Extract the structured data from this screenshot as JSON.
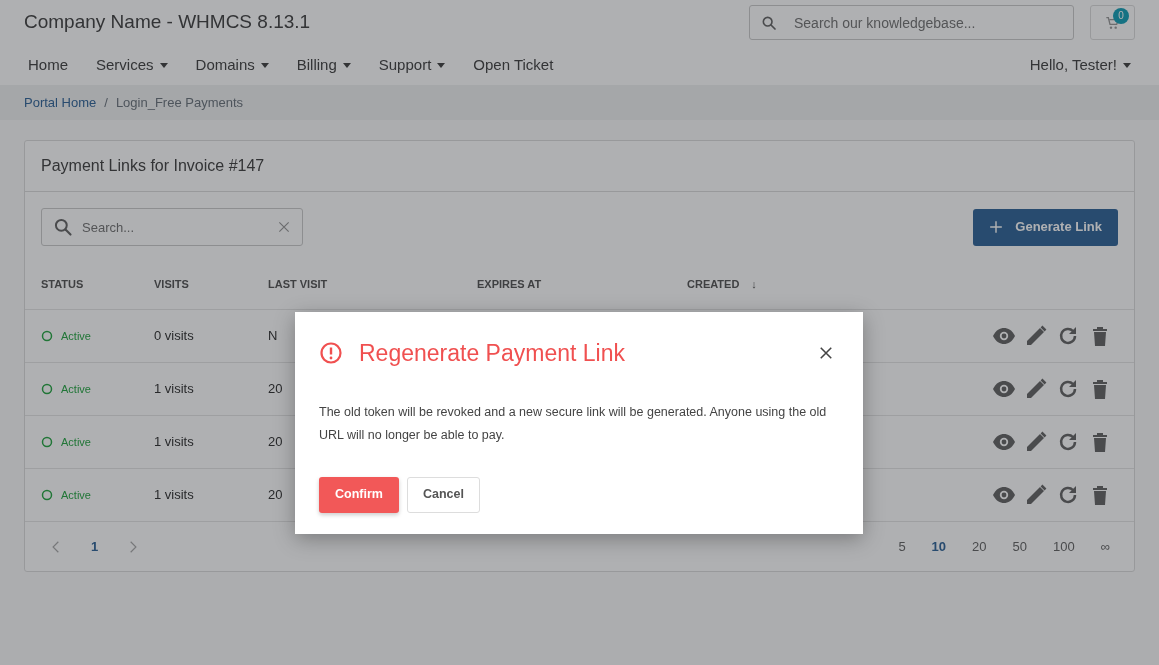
{
  "header": {
    "brand": "Company Name - WHMCS 8.13.1",
    "search": {
      "placeholder": "Search our knowledgebase..."
    },
    "cart_count": "0"
  },
  "nav": {
    "items": [
      {
        "label": "Home",
        "dropdown": false
      },
      {
        "label": "Services",
        "dropdown": true
      },
      {
        "label": "Domains",
        "dropdown": true
      },
      {
        "label": "Billing",
        "dropdown": true
      },
      {
        "label": "Support",
        "dropdown": true
      },
      {
        "label": "Open Ticket",
        "dropdown": false
      }
    ],
    "user": {
      "label": "Hello, Tester!",
      "dropdown": true
    }
  },
  "breadcrumb": {
    "separator": "/",
    "items": [
      {
        "label": "Portal Home",
        "link": true
      },
      {
        "label": "Login_Free Payments",
        "link": false
      }
    ]
  },
  "card": {
    "title": "Payment Links for Invoice #147",
    "search": {
      "placeholder": "Search..."
    },
    "generate_button": "Generate Link",
    "table": {
      "columns": [
        {
          "label": "STATUS"
        },
        {
          "label": "VISITS"
        },
        {
          "label": "LAST VISIT"
        },
        {
          "label": "EXPIRES AT"
        },
        {
          "label": "CREATED",
          "sort": "↓"
        }
      ],
      "rows": [
        {
          "status": "Active",
          "visits": "0 visits",
          "last_visit": "N"
        },
        {
          "status": "Active",
          "visits": "1 visits",
          "last_visit": "20"
        },
        {
          "status": "Active",
          "visits": "1 visits",
          "last_visit": "20"
        },
        {
          "status": "Active",
          "visits": "1 visits",
          "last_visit": "20"
        }
      ]
    },
    "pagination": {
      "pages": [
        {
          "label": "1",
          "selected": true
        }
      ],
      "page_sizes": [
        {
          "label": "5",
          "selected": false
        },
        {
          "label": "10",
          "selected": true
        },
        {
          "label": "20",
          "selected": false
        },
        {
          "label": "50",
          "selected": false
        },
        {
          "label": "100",
          "selected": false
        },
        {
          "label": "∞",
          "selected": false
        }
      ]
    }
  },
  "modal": {
    "title": "Regenerate Payment Link",
    "body": "The old token will be revoked and a new secure link will be generated. Anyone using the old URL will no longer be able to pay.",
    "buttons": [
      {
        "label": "Confirm",
        "kind": "primary"
      },
      {
        "label": "Cancel",
        "kind": "secondary"
      }
    ]
  }
}
